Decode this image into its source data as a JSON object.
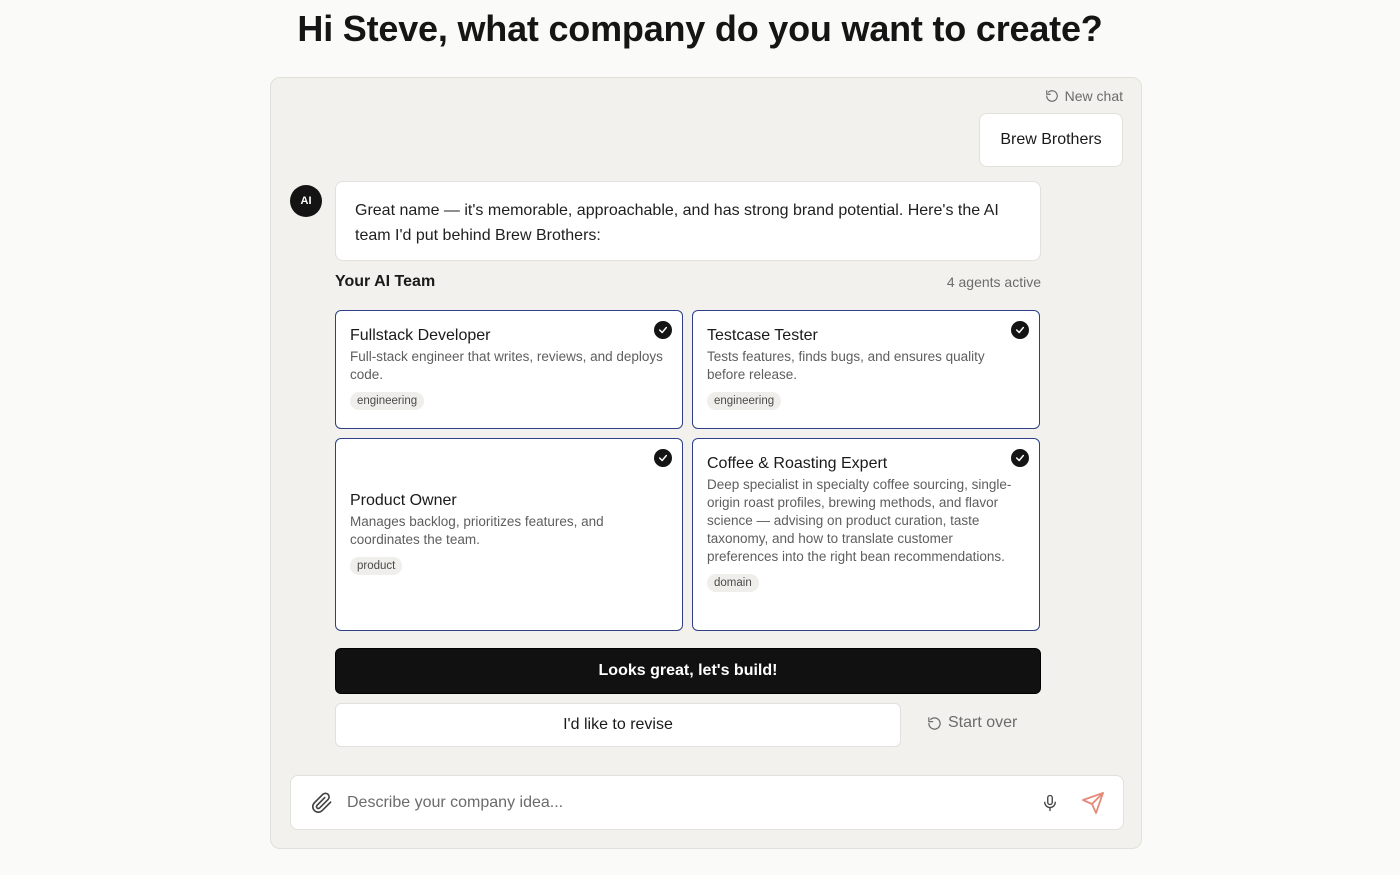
{
  "page": {
    "title": "Hi Steve, what company do you want to create?"
  },
  "chat": {
    "new_chat_label": "New chat",
    "user_message": "Brew Brothers",
    "ai_avatar_label": "AI",
    "ai_message": "Great name — it's memorable, approachable, and has strong brand potential. Here's the AI team I'd put behind Brew Brothers:"
  },
  "team": {
    "title": "Your AI Team",
    "count_label": "4 agents active",
    "agents": [
      {
        "name": "Fullstack Developer",
        "description": "Full-stack engineer that writes, reviews, and deploys code.",
        "tag": "engineering",
        "selected": true
      },
      {
        "name": "Testcase Tester",
        "description": "Tests features, finds bugs, and ensures quality before release.",
        "tag": "engineering",
        "selected": true
      },
      {
        "name": "Product Owner",
        "description": "Manages backlog, prioritizes features, and coordinates the team.",
        "tag": "product",
        "selected": true
      },
      {
        "name": "Coffee & Roasting Expert",
        "description": "Deep specialist in specialty coffee sourcing, single-origin roast profiles, brewing methods, and flavor science — advising on product curation, taste taxonomy, and how to translate customer preferences into the right bean recommendations.",
        "tag": "domain",
        "selected": true
      }
    ]
  },
  "actions": {
    "build_label": "Looks great, let's build!",
    "revise_label": "I'd like to revise",
    "start_over_label": "Start over"
  },
  "composer": {
    "placeholder": "Describe your company idea...",
    "value": ""
  },
  "colors": {
    "card_border": "#2f3f87",
    "primary_button": "#111111",
    "send_icon": "#e58a78",
    "panel_bg": "#f2f1ed"
  }
}
